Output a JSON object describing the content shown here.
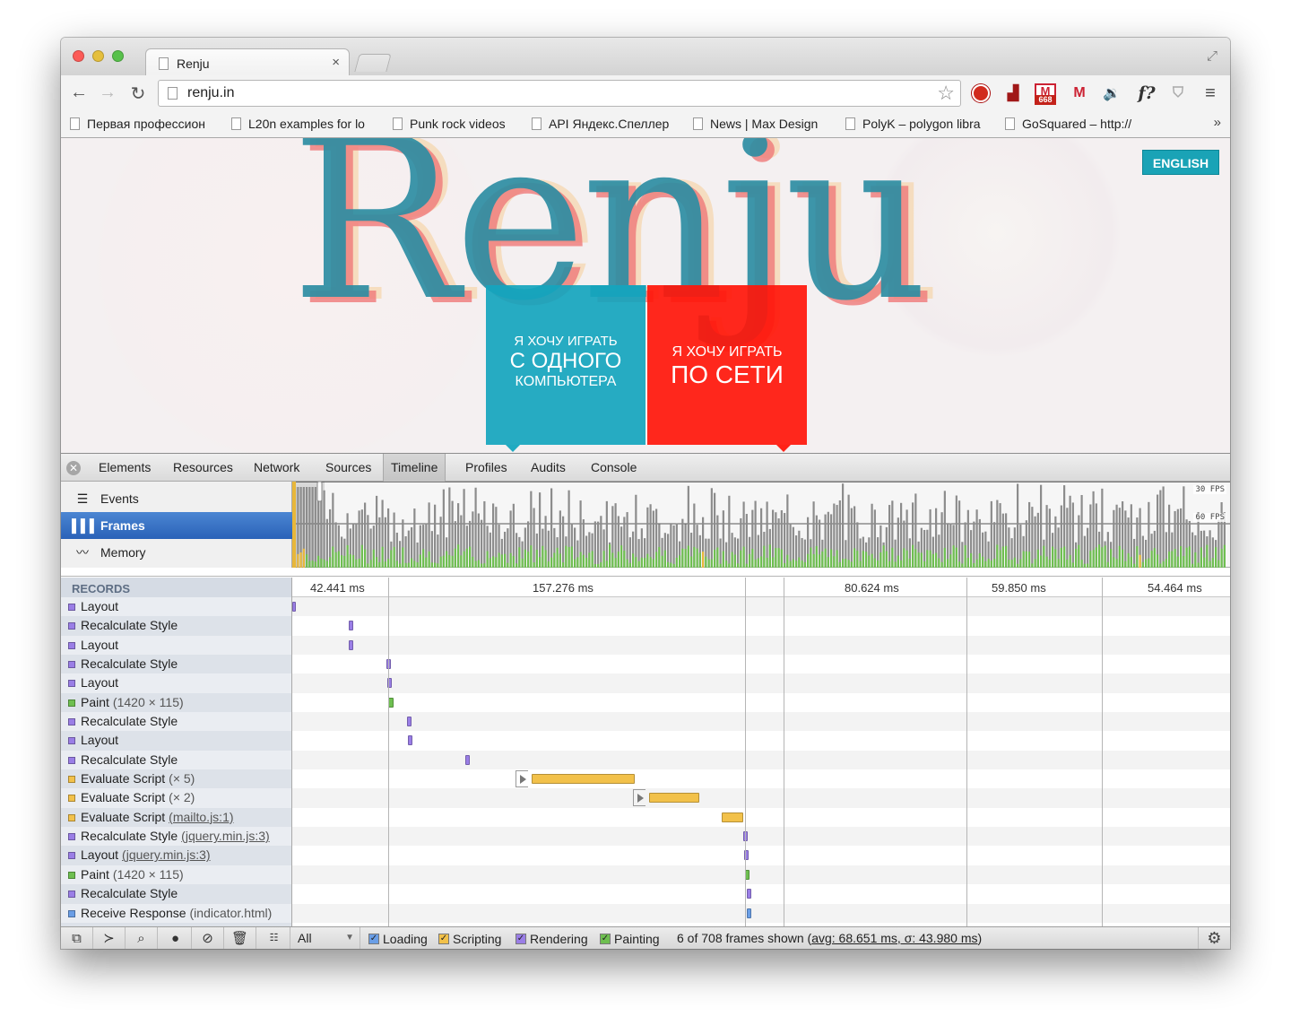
{
  "browser": {
    "tab_title": "Renju",
    "tab_close": "×",
    "url": "renju.in",
    "bookmarks": [
      "Первая профессион",
      "L20n examples for lo",
      "Punk rock videos",
      "API Яндекс.Спеллер",
      "News | Max Design",
      "PolyK – polygon libra",
      "GoSquared – http://"
    ],
    "bookmarks_more": "»",
    "extensions": {
      "gmail_badge": "668",
      "f_label": "f?"
    }
  },
  "site": {
    "logo_text": "Renju",
    "language_button": "ENGLISH",
    "cta_local": {
      "line1": "Я ХОЧУ ИГРАТЬ",
      "line2": "С ОДНОГО",
      "line3": "КОМПЬЮТЕРА"
    },
    "cta_online": {
      "line1": "Я ХОЧУ ИГРАТЬ",
      "line2": "ПО СЕТИ"
    },
    "colors": {
      "teal": "#14a5be",
      "red": "#ff160a",
      "logo_teal": "#2e8ea3",
      "logo_shadow_red": "#f07a7a"
    }
  },
  "devtools": {
    "tabs": [
      "Elements",
      "Resources",
      "Network",
      "Sources",
      "Timeline",
      "Profiles",
      "Audits",
      "Console"
    ],
    "selected_tab": "Timeline",
    "modes": [
      {
        "label": "Events",
        "icon": "events-icon"
      },
      {
        "label": "Frames",
        "icon": "frames-icon"
      },
      {
        "label": "Memory",
        "icon": "memory-icon"
      }
    ],
    "selected_mode": "Frames",
    "fps_30": "30 FPS",
    "fps_60": "60 FPS",
    "records_header": "RECORDS",
    "frame_durations": [
      "42.441 ms",
      "157.276 ms",
      "80.624 ms",
      "59.850 ms",
      "54.464 ms"
    ],
    "records": [
      {
        "name": "Layout",
        "type": "rendering",
        "detail": "",
        "link": ""
      },
      {
        "name": "Recalculate Style",
        "type": "rendering",
        "detail": "",
        "link": ""
      },
      {
        "name": "Layout",
        "type": "rendering",
        "detail": "",
        "link": ""
      },
      {
        "name": "Recalculate Style",
        "type": "rendering",
        "detail": "",
        "link": ""
      },
      {
        "name": "Layout",
        "type": "rendering",
        "detail": "",
        "link": ""
      },
      {
        "name": "Paint",
        "type": "painting",
        "detail": "(1420 × 115)",
        "link": ""
      },
      {
        "name": "Recalculate Style",
        "type": "rendering",
        "detail": "",
        "link": ""
      },
      {
        "name": "Layout",
        "type": "rendering",
        "detail": "",
        "link": ""
      },
      {
        "name": "Recalculate Style",
        "type": "rendering",
        "detail": "",
        "link": ""
      },
      {
        "name": "Evaluate Script",
        "type": "scripting",
        "detail": "(× 5)",
        "link": ""
      },
      {
        "name": "Evaluate Script",
        "type": "scripting",
        "detail": "(× 2)",
        "link": ""
      },
      {
        "name": "Evaluate Script",
        "type": "scripting",
        "detail": "",
        "link": "(mailto.js:1)"
      },
      {
        "name": "Recalculate Style",
        "type": "rendering",
        "detail": "",
        "link": "(jquery.min.js:3)"
      },
      {
        "name": "Layout",
        "type": "rendering",
        "detail": "",
        "link": "(jquery.min.js:3)"
      },
      {
        "name": "Paint",
        "type": "painting",
        "detail": "(1420 × 115)",
        "link": ""
      },
      {
        "name": "Recalculate Style",
        "type": "rendering",
        "detail": "",
        "link": ""
      },
      {
        "name": "Receive Response",
        "type": "loading",
        "detail": "(indicator.html)",
        "link": ""
      }
    ],
    "category_colors": {
      "rendering": "#9a7ee6",
      "painting": "#6ebf50",
      "scripting": "#f2c14a",
      "loading": "#6a9ee6"
    },
    "filter": {
      "value": "All"
    },
    "categories": [
      {
        "label": "Loading",
        "checked": true,
        "color": "#6a9ee6"
      },
      {
        "label": "Scripting",
        "checked": true,
        "color": "#f2c14a"
      },
      {
        "label": "Rendering",
        "checked": true,
        "color": "#9a7ee6"
      },
      {
        "label": "Painting",
        "checked": true,
        "color": "#6ebf50"
      }
    ],
    "summary_prefix": "6 of 708 frames shown (",
    "summary_stats": "avg: 68.651 ms, σ: 43.980 ms",
    "summary_suffix": ")"
  }
}
